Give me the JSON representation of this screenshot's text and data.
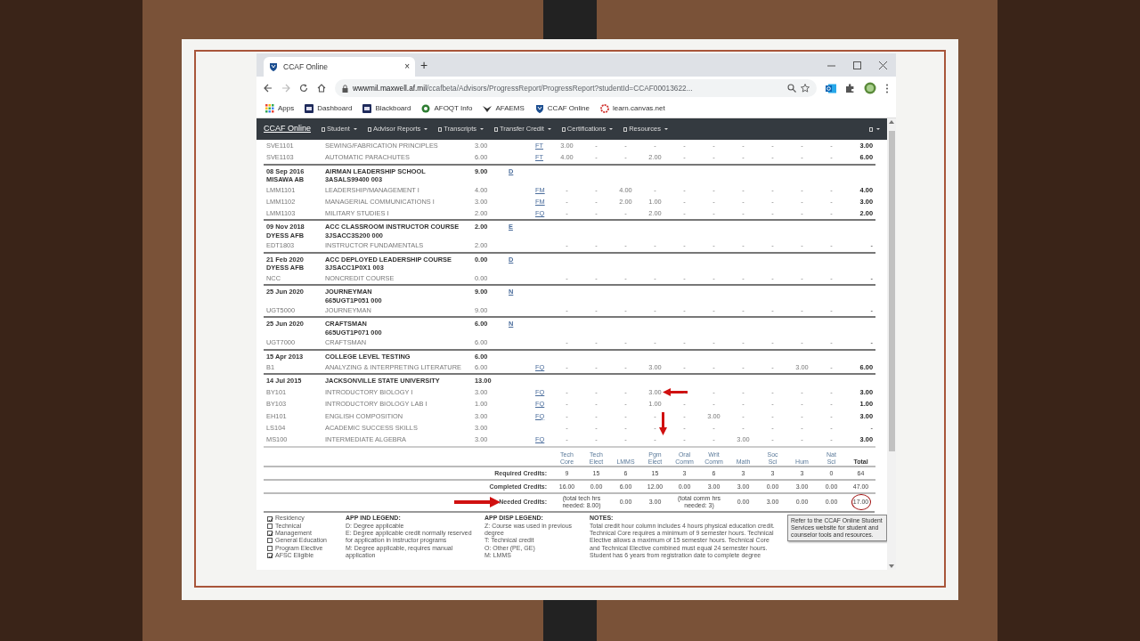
{
  "browser": {
    "tab_title": "CCAF Online",
    "tab_close": "×",
    "new_tab": "+",
    "url_host": "wwwmil.maxwell.af.mil",
    "url_path": "/ccafbeta/Advisors/ProgressReport/ProgressReport?studentId=CCAF00013622...",
    "bookmarks": [
      {
        "label": "Apps",
        "kind": "apps"
      },
      {
        "label": "Dashboard",
        "kind": "square"
      },
      {
        "label": "Blackboard",
        "kind": "square"
      },
      {
        "label": "AFOQT Info",
        "kind": "circle"
      },
      {
        "label": "AFAEMS",
        "kind": "wings"
      },
      {
        "label": "CCAF Online",
        "kind": "shield"
      },
      {
        "label": "learn.canvas.net",
        "kind": "ring"
      }
    ]
  },
  "navbar": {
    "brand": "CCAF Online",
    "menus": [
      {
        "label": "Student"
      },
      {
        "label": "Advisor Reports"
      },
      {
        "label": "Transcripts"
      },
      {
        "label": "Transfer Credit"
      },
      {
        "label": "Certifications"
      },
      {
        "label": "Resources"
      }
    ]
  },
  "records": [
    {
      "kind": "course",
      "code": "SVE1101",
      "title": "SEWING/FABRICATION PRINCIPLES",
      "hours": "3.00",
      "app_disp": "FT",
      "values": [
        "3.00",
        "-",
        "-",
        "-",
        "-",
        "-",
        "-",
        "-",
        "-",
        "-"
      ],
      "total": "3.00"
    },
    {
      "kind": "course",
      "code": "SVE1103",
      "title": "AUTOMATIC PARACHUTES",
      "hours": "6.00",
      "app_disp": "FT",
      "values": [
        "4.00",
        "-",
        "-",
        "2.00",
        "-",
        "-",
        "-",
        "-",
        "-",
        "-"
      ],
      "total": "6.00"
    },
    {
      "kind": "institution",
      "date": "08 Sep 2016",
      "location": "MISAWA AB",
      "title": "AIRMAN LEADERSHIP SCHOOL",
      "code": "3ASALS99400 003",
      "hours": "9.00",
      "app_ind": "D"
    },
    {
      "kind": "course",
      "code": "LMM1101",
      "title": "LEADERSHIP/MANAGEMENT I",
      "hours": "4.00",
      "app_disp": "FM",
      "values": [
        "-",
        "-",
        "4.00",
        "-",
        "-",
        "-",
        "-",
        "-",
        "-",
        "-"
      ],
      "total": "4.00"
    },
    {
      "kind": "course",
      "code": "LMM1102",
      "title": "MANAGERIAL COMMUNICATIONS I",
      "hours": "3.00",
      "app_disp": "FM",
      "values": [
        "-",
        "-",
        "2.00",
        "1.00",
        "-",
        "-",
        "-",
        "-",
        "-",
        "-"
      ],
      "total": "3.00"
    },
    {
      "kind": "course",
      "code": "LMM1103",
      "title": "MILITARY STUDIES I",
      "hours": "2.00",
      "app_disp": "FQ",
      "values": [
        "-",
        "-",
        "-",
        "2.00",
        "-",
        "-",
        "-",
        "-",
        "-",
        "-"
      ],
      "total": "2.00"
    },
    {
      "kind": "institution",
      "date": "09 Nov 2018",
      "location": "DYESS AFB",
      "title": "ACC CLASSROOM INSTRUCTOR COURSE",
      "code": "3JSACC3S200 000",
      "hours": "2.00",
      "app_ind": "E"
    },
    {
      "kind": "course",
      "code": "EDT1803",
      "title": "INSTRUCTOR FUNDAMENTALS",
      "hours": "2.00",
      "values": [
        "-",
        "-",
        "-",
        "-",
        "-",
        "-",
        "-",
        "-",
        "-",
        "-"
      ],
      "total": "-"
    },
    {
      "kind": "institution",
      "date": "21 Feb 2020",
      "location": "DYESS AFB",
      "title": "ACC DEPLOYED LEADERSHIP COURSE",
      "code": "3JSACC1P0X1 003",
      "hours": "0.00",
      "app_ind": "D"
    },
    {
      "kind": "course",
      "code": "NCC",
      "title": "NONCREDIT COURSE",
      "hours": "0.00",
      "values": [
        "-",
        "-",
        "-",
        "-",
        "-",
        "-",
        "-",
        "-",
        "-",
        "-"
      ],
      "total": "-"
    },
    {
      "kind": "institution",
      "date": "25 Jun 2020",
      "title": "JOURNEYMAN",
      "code": "665UGT1P051 000",
      "hours": "9.00",
      "app_ind": "N"
    },
    {
      "kind": "course",
      "code": "UGT5000",
      "title": "JOURNEYMAN",
      "hours": "9.00",
      "values": [
        "-",
        "-",
        "-",
        "-",
        "-",
        "-",
        "-",
        "-",
        "-",
        "-"
      ],
      "total": "-"
    },
    {
      "kind": "institution",
      "date": "25 Jun 2020",
      "title": "CRAFTSMAN",
      "code": "665UGT1P071 000",
      "hours": "6.00",
      "app_ind": "N"
    },
    {
      "kind": "course",
      "code": "UGT7000",
      "title": "CRAFTSMAN",
      "hours": "6.00",
      "values": [
        "-",
        "-",
        "-",
        "-",
        "-",
        "-",
        "-",
        "-",
        "-",
        "-"
      ],
      "total": "-"
    },
    {
      "kind": "institution",
      "date": "15 Apr 2013",
      "title": "COLLEGE LEVEL TESTING",
      "hours": "6.00"
    },
    {
      "kind": "course",
      "code": "B1",
      "title": "ANALYZING & INTERPRETING LITERATURE",
      "hours": "6.00",
      "app_disp": "FQ",
      "values": [
        "-",
        "-",
        "-",
        "3.00",
        "-",
        "-",
        "-",
        "-",
        "3.00",
        "-"
      ],
      "total": "6.00"
    },
    {
      "kind": "institution",
      "date": "14 Jul 2015",
      "title": "JACKSONVILLE STATE UNIVERSITY",
      "hours": "13.00"
    },
    {
      "kind": "course",
      "code": "BY101",
      "title": "INTRODUCTORY BIOLOGY I",
      "hours": "3.00",
      "app_disp": "FQ",
      "values": [
        "-",
        "-",
        "-",
        "3.00",
        "-",
        "-",
        "-",
        "-",
        "-",
        "-"
      ],
      "total": "3.00",
      "arrow_left": true
    },
    {
      "kind": "course",
      "code": "BY103",
      "title": "INTRODUCTORY BIOLOGY LAB I",
      "hours": "1.00",
      "app_disp": "FQ",
      "values": [
        "-",
        "-",
        "-",
        "1.00",
        "-",
        "-",
        "-",
        "-",
        "-",
        "-"
      ],
      "total": "1.00"
    },
    {
      "kind": "course",
      "code": "EH101",
      "title": "ENGLISH COMPOSITION",
      "hours": "3.00",
      "app_disp": "FQ",
      "values": [
        "-",
        "-",
        "-",
        "-",
        "-",
        "3.00",
        "-",
        "-",
        "-",
        "-"
      ],
      "total": "3.00"
    },
    {
      "kind": "course",
      "code": "LS104",
      "title": "ACADEMIC SUCCESS SKILLS",
      "hours": "3.00",
      "values": [
        "-",
        "-",
        "-",
        "-",
        "-",
        "-",
        "-",
        "-",
        "-",
        "-"
      ],
      "total": "-",
      "arrow_down": true
    },
    {
      "kind": "course",
      "code": "MS100",
      "title": "INTERMEDIATE ALGEBRA",
      "hours": "3.00",
      "app_disp": "FQ",
      "values": [
        "-",
        "-",
        "-",
        "-",
        "-",
        "-",
        "3.00",
        "-",
        "-",
        "-"
      ],
      "total": "3.00"
    }
  ],
  "summary": {
    "columns": [
      {
        "line1": "Tech",
        "line2": "Core"
      },
      {
        "line1": "Tech",
        "line2": "Elect"
      },
      {
        "line1": "LMMS"
      },
      {
        "line1": "Pgm",
        "line2": "Elect"
      },
      {
        "line1": "Oral",
        "line2": "Comm"
      },
      {
        "line1": "Writ",
        "line2": "Comm"
      },
      {
        "line1": "Math"
      },
      {
        "line1": "Soc",
        "line2": "Sci"
      },
      {
        "line1": "Hum"
      },
      {
        "line1": "Nat",
        "line2": "Sci"
      },
      {
        "line1": "Total",
        "kind": "total"
      }
    ],
    "rows": [
      {
        "label": "Required Credits:",
        "cells": [
          {
            "text": "9"
          },
          {
            "text": "15"
          },
          {
            "text": "6"
          },
          {
            "text": "15"
          },
          {
            "text": "3"
          },
          {
            "text": "6"
          },
          {
            "text": "3"
          },
          {
            "text": "3"
          },
          {
            "text": "3"
          },
          {
            "text": "0"
          },
          {
            "text": "64"
          }
        ]
      },
      {
        "label": "Completed Credits:",
        "cells": [
          {
            "text": "16.00"
          },
          {
            "text": "0.00"
          },
          {
            "text": "6.00"
          },
          {
            "text": "12.00"
          },
          {
            "text": "0.00"
          },
          {
            "text": "3.00"
          },
          {
            "text": "3.00"
          },
          {
            "text": "0.00"
          },
          {
            "text": "3.00"
          },
          {
            "text": "0.00"
          },
          {
            "text": "47.00"
          }
        ]
      },
      {
        "label": "Needed Credits:",
        "arrow_right": true,
        "cells": [
          {
            "text": "(total tech hrs needed: 8.00)",
            "kind": "note"
          },
          {
            "text": ""
          },
          {
            "text": "0.00"
          },
          {
            "text": "3.00"
          },
          {
            "text": "(total comm hrs needed: 3)",
            "kind": "note"
          },
          {
            "text": ""
          },
          {
            "text": "0.00"
          },
          {
            "text": "3.00"
          },
          {
            "text": "0.00"
          },
          {
            "text": "0.00"
          },
          {
            "text": "17.00",
            "circled": true
          }
        ]
      }
    ]
  },
  "legend": {
    "checks": [
      {
        "label": "Residency",
        "checked": true
      },
      {
        "label": "Technical",
        "checked": false
      },
      {
        "label": "Management",
        "checked": true
      },
      {
        "label": "General Education",
        "checked": false
      },
      {
        "label": "Program Elective",
        "checked": false
      },
      {
        "label": "AFSC Eligible",
        "checked": true
      }
    ],
    "app_ind": {
      "title": "APP IND LEGEND:",
      "items": [
        "D: Degree applicable",
        "E: Degree applicable credit normally reserved for application in instructor programs",
        "M: Degree applicable, requires manual application"
      ]
    },
    "app_disp": {
      "title": "APP DISP LEGEND:",
      "items": [
        "Z: Course was used in previous degree",
        "T: Technical credit",
        "O: Other (PE, GE)",
        "M: LMMS"
      ]
    },
    "notes": {
      "title": "NOTES:",
      "text": "Total credit hour column includes 4 hours physical education credit. Technical Core requires a minimum of 9 semester hours. Technical Elective allows a maximum of 15 semester hours. Technical Core and Technical Elective combined must equal 24 semester hours. Student has 6 years from registration date to complete degree"
    },
    "info": "Refer to the CCAF Online Student Services website for student and counselor tools and resources."
  }
}
